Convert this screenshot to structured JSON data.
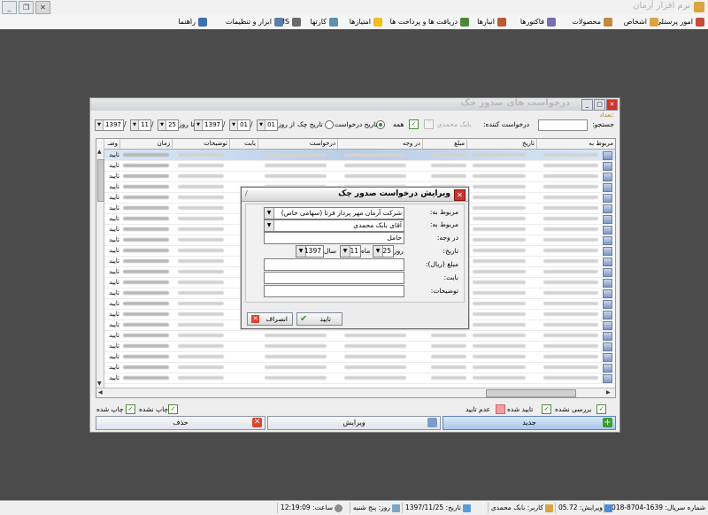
{
  "app": {
    "title": "نرم افزار آرمان"
  },
  "menu": [
    {
      "label": "امور پرسنلی",
      "color": "#c74b3a"
    },
    {
      "label": "اشخاص",
      "color": "#d9a441"
    },
    {
      "label": "محصولات",
      "color": "#c28a3c"
    },
    {
      "label": "فاکتورها",
      "color": "#7a6fb4"
    },
    {
      "label": "انبارها",
      "color": "#b85c2d"
    },
    {
      "label": "دریافت ها و پرداخت ها",
      "color": "#4a8a3a"
    },
    {
      "label": "امتیازها",
      "color": "#f0c020"
    },
    {
      "label": "کارتها",
      "color": "#5f8fb0"
    },
    {
      "label": "SMS",
      "color": "#6a6a6a"
    },
    {
      "label": "ابزار و تنظیمات",
      "color": "#5b7ea8"
    },
    {
      "label": "راهنما",
      "color": "#3d6fb3"
    }
  ],
  "checks_window": {
    "title": "درخواست های صدور چک",
    "count_label": "تعداد:",
    "search_label": "جستجو:",
    "requester_label": "درخواست کننده:",
    "requester_value": "بابک محمدی",
    "all_label": "همه",
    "radio_request_date": "تاریخ درخواست",
    "radio_check_date": "تاریخ چک",
    "from_label": "از روز",
    "to_label": "تا روز",
    "from": {
      "day": "01",
      "month": "01",
      "year": "1397"
    },
    "to": {
      "day": "25",
      "month": "11",
      "year": "1397"
    },
    "columns": [
      "مربوط به",
      "تاریخ",
      "مبلغ",
      "در وجه",
      "درخواست",
      "بابت",
      "توضیحات",
      "زمان",
      "وضـ"
    ],
    "rows": [
      {
        "status": "تایید"
      },
      {
        "status": "تایید"
      },
      {
        "status": "تایید"
      },
      {
        "status": "تایید"
      },
      {
        "status": "تایید"
      },
      {
        "status": "تایید"
      },
      {
        "status": "تایید"
      },
      {
        "status": "تایید"
      },
      {
        "status": "تایید"
      },
      {
        "status": "تایید"
      },
      {
        "status": "تایید"
      },
      {
        "status": "تایید"
      },
      {
        "status": "تایید"
      },
      {
        "status": "تایید"
      },
      {
        "status": "تایید"
      },
      {
        "status": "تایید"
      },
      {
        "status": "تایید"
      },
      {
        "status": "تایید"
      },
      {
        "status": "تایید"
      },
      {
        "status": "تایید"
      },
      {
        "status": "تایید"
      },
      {
        "status": "تایید"
      }
    ],
    "legend": {
      "unreviewed": "بررسی نشده",
      "approved": "تایید شده",
      "rejected": "عدم تایید",
      "printed": "چاپ شده",
      "not_printed": "چاپ نشده"
    },
    "buttons": {
      "new": "جدید",
      "edit": "ویرایش",
      "delete": "حذف"
    }
  },
  "dialog": {
    "title": "ویرایش درخواست صدور چک",
    "related_to_label": "مربوط به:",
    "related_to_value": "شرکت آرمان مهر پرداز فرتا (سهامی خاص)",
    "related_person_label": "مربوط به:",
    "related_person_value": "آقای بابک محمدی",
    "payee_label": "در وجه:",
    "payee_value": "حامل",
    "date_label": "تاریخ:",
    "day_label": "روز",
    "month_label": "ماه",
    "year_label": "سال",
    "date": {
      "day": "25",
      "month": "11",
      "year": "1397"
    },
    "amount_label": "مبلغ (ریال):",
    "for_label": "بابت:",
    "notes_label": "توضیحات:",
    "ok_label": "تایید",
    "cancel_label": "انصراف"
  },
  "taskbar": {
    "serial": "شماره سریال: 1639-8704-2018",
    "version": "ویرایش: 05.72",
    "user": "کاربر: بابک محمدی",
    "date": "تاریخ: 1397/11/25",
    "day": "روز: پنج شنبه",
    "time": "ساعت: 12:19:09"
  }
}
